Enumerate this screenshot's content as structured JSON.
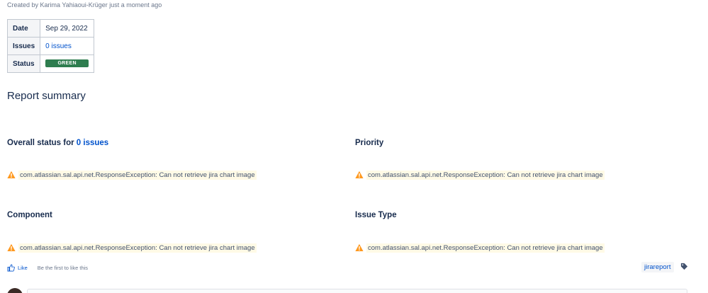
{
  "byline": "Created by Karima Yahiaoui-Krüger just a moment ago",
  "meta_table": [
    {
      "key": "Date",
      "value": "Sep 29, 2022"
    },
    {
      "key": "Issues",
      "value": "0 issues"
    },
    {
      "key": "Status",
      "value": "GREEN"
    }
  ],
  "status_color": "#2e7d4f",
  "summary_heading": "Report summary",
  "panels": {
    "overall": {
      "title_prefix": "Overall status for ",
      "title_link": "0 issues"
    },
    "priority": {
      "title": "Priority"
    },
    "component": {
      "title": "Component"
    },
    "issue_type": {
      "title": "Issue Type"
    }
  },
  "error_message": "com.atlassian.sal.api.net.ResponseException: Can not retrieve jira chart image",
  "warning_icon": "warning-icon",
  "like": {
    "label": "Like",
    "note": "Be the first to like this"
  },
  "labels": [
    "jirareport"
  ],
  "colors": {
    "link": "#0052cc",
    "text": "#172b4d",
    "warning": "#ff991f",
    "warning_bg": "#fffae6"
  }
}
